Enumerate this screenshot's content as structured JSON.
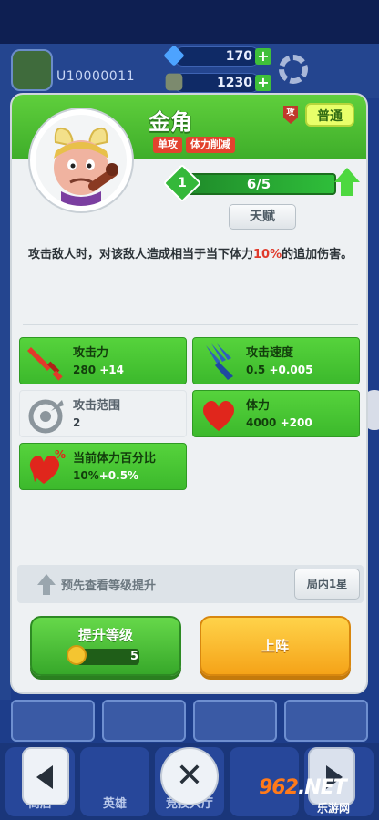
{
  "background": {
    "user_id": "U10000011",
    "currency_gems": "170",
    "currency_gold": "1230",
    "nav_labels": [
      "商店",
      "英雄",
      "竞技大厅",
      "",
      ""
    ]
  },
  "hero": {
    "name": "金角",
    "tags": [
      "单攻",
      "体力削减"
    ],
    "type_badge": "攻",
    "rarity": "普通",
    "level": "1",
    "cards_progress": "6/5",
    "talent_label": "天赋",
    "description_pre": "攻击敌人时，对该敌人造成相当于当下体力",
    "description_highlight": "10%",
    "description_post": "的追加伤害。"
  },
  "stats": [
    {
      "title": "攻击力",
      "value": "280",
      "bonus": "+14",
      "icon": "sword-icon",
      "highlight": true
    },
    {
      "title": "攻击速度",
      "value": "0.5",
      "bonus": "+0.005",
      "icon": "speed-claw-icon",
      "highlight": true
    },
    {
      "title": "攻击范围",
      "value": "2",
      "bonus": "",
      "icon": "target-range-icon",
      "highlight": false
    },
    {
      "title": "体力",
      "value": "4000",
      "bonus": "+200",
      "icon": "heart-icon",
      "highlight": true
    },
    {
      "title": "当前体力百分比",
      "value": "10%",
      "bonus": "+0.5%",
      "icon": "broken-heart-percent-icon",
      "highlight": true
    }
  ],
  "preview": {
    "label": "预先查看等级提升",
    "button": "局内1星"
  },
  "actions": {
    "upgrade_label": "提升等级",
    "upgrade_cost": "5",
    "deploy_label": "上阵"
  },
  "watermark": {
    "logo_text": "962",
    "logo_suffix": ".NET",
    "sub_text": "乐游网"
  },
  "colors": {
    "header_green": "#4cc032",
    "stat_green": "#46c232",
    "highlight_red": "#e03a2b",
    "deploy_orange": "#f5a318"
  }
}
